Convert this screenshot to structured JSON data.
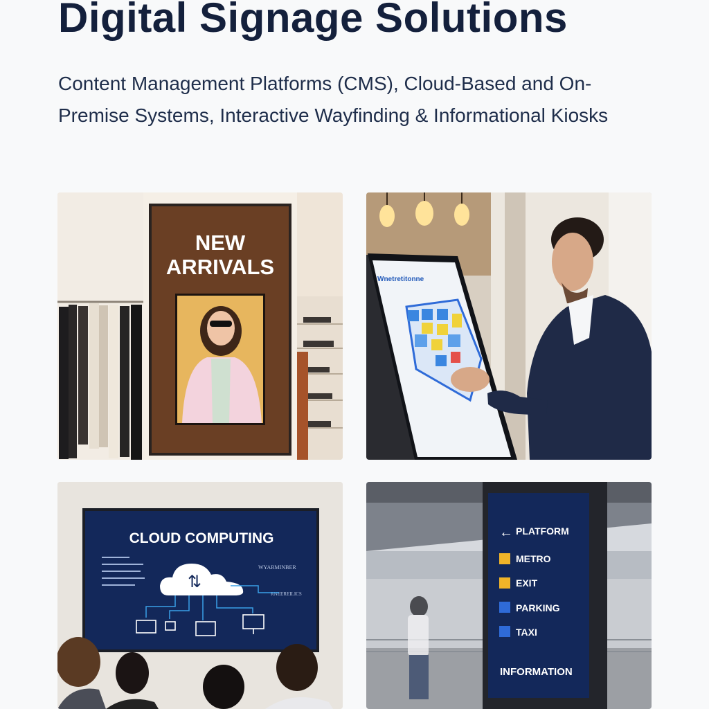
{
  "hero": {
    "title": "Digital Signage Solutions",
    "subtitle": "Content Management Platforms (CMS), Cloud-Based and On-Premise Systems, Interactive Wayfinding & Informational Kiosks"
  },
  "cards": {
    "retail": {
      "line1": "NEW",
      "line2": "ARRIVALS"
    },
    "kiosk": {
      "map_title": "Wnetretitonne"
    },
    "cloud": {
      "screen_title": "CLOUD COMPUTING",
      "side_label_1": "WYARMINBER",
      "side_label_2": "RNEEREILICS"
    },
    "wayfinding": {
      "items": [
        {
          "label": "PLATFORM",
          "icon": "arrow-left-icon"
        },
        {
          "label": "METRO",
          "icon": "metro-icon"
        },
        {
          "label": "EXIT",
          "icon": "exit-icon"
        },
        {
          "label": "PARKING",
          "icon": "parking-icon"
        },
        {
          "label": "TAXI",
          "icon": "taxi-icon"
        }
      ],
      "footer": "INFORMATION"
    }
  },
  "colors": {
    "title": "#14203c",
    "screen_navy": "#13285a",
    "accent_amber": "#f0b429",
    "accent_blue": "#2f6bd8"
  }
}
